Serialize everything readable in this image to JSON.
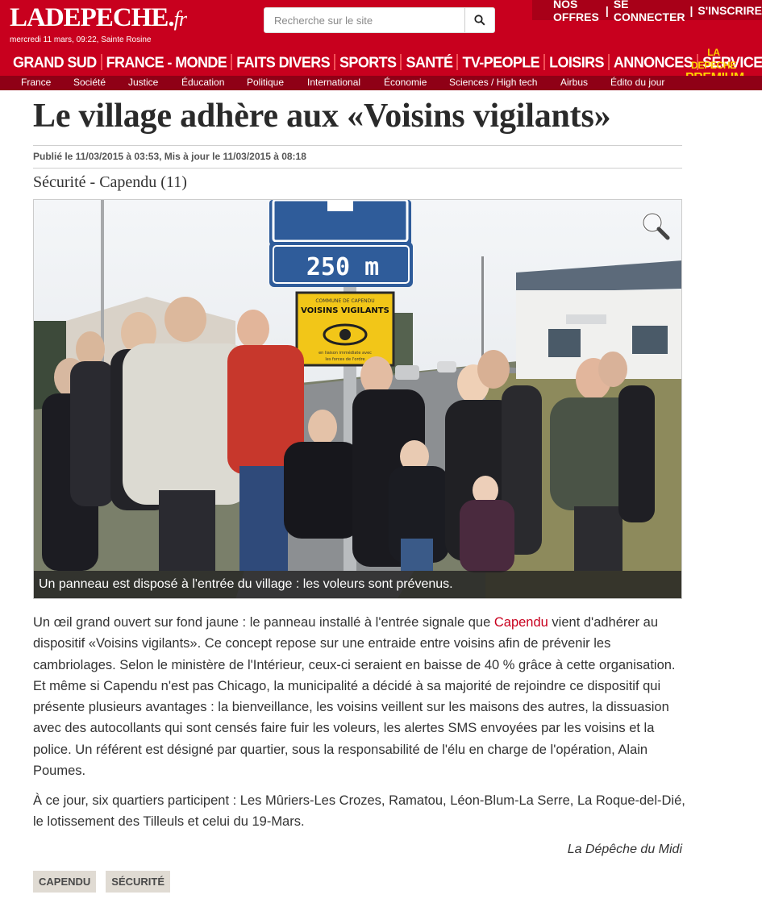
{
  "header": {
    "logo_main": "LADEPECHE",
    "logo_dot": ".",
    "logo_fr": "fr",
    "date_line": "mercredi 11 mars, 09:22, Sainte Rosine",
    "search_placeholder": "Recherche sur le site",
    "top_links": [
      "NOS OFFRES",
      "SE CONNECTER",
      "S'INSCRIRE"
    ],
    "top_link_separator": "|",
    "main_nav": [
      "GRAND SUD",
      "FRANCE - MONDE",
      "FAITS DIVERS",
      "SPORTS",
      "SANTÉ",
      "TV-PEOPLE",
      "LOISIRS",
      "ANNONCES",
      "SERVICES+"
    ],
    "premium_line1": "LA DEPECHE",
    "premium_line2": "PREMIUM",
    "sub_nav": [
      "France",
      "Société",
      "Justice",
      "Éducation",
      "Politique",
      "International",
      "Économie",
      "Sciences / High tech",
      "Airbus",
      "Édito du jour"
    ],
    "colors": {
      "brand_red": "#c8001e",
      "sub_nav_red": "#8f0016",
      "premium_yellow": "#ffd200"
    }
  },
  "article": {
    "title": "Le village adhère aux «Voisins vigilants»",
    "published": "Publié le 11/03/2015 à 03:53, Mis à jour le 11/03/2015 à 08:18",
    "rubrique": "Sécurité - Capendu (11)",
    "photo": {
      "caption": "Un panneau est disposé à l'entrée du village : les voleurs sont prévenus.",
      "sign_distance": "250 m",
      "sign_commune": "COMMUNE DE CAPENDU",
      "sign_title": "VOISINS VIGILANTS",
      "sign_sub1": "en liaison immédiate avec",
      "sign_sub2": "les forces de l'ordre",
      "zoom_icon": "magnifier-icon"
    },
    "paragraph1_before_link": "Un œil grand ouvert sur fond jaune : le panneau installé à l'entrée signale que ",
    "paragraph1_link": "Capendu",
    "paragraph1_after_link": " vient d'adhérer au dispositif «Voisins vigilants». Ce concept repose sur une entraide entre voisins afin de prévenir les cambriolages. Selon le ministère de l'Intérieur, ceux-ci seraient en baisse de 40 % grâce à cette organisation. Et même si Capendu n'est pas Chicago, la municipalité a décidé à sa majorité de rejoindre ce dispositif qui présente plusieurs avantages : la bienveillance, les voisins veillent sur les maisons des autres, la dissuasion avec des autocollants qui sont censés faire fuir les voleurs, les alertes SMS envoyées par les voisins et la police. Un référent est désigné par quartier, sous la responsabilité de l'élu en charge de l'opération, Alain Poumes.",
    "paragraph2": "À ce jour, six quartiers participent : Les Mûriers-Les Crozes, Ramatou, Léon-Blum-La Serre, La Roque-del-Dié, le lotissement des Tilleuls et celui du 19-Mars.",
    "signature": "La Dépêche du Midi",
    "tags": [
      "CAPENDU",
      "SÉCURITÉ"
    ]
  }
}
